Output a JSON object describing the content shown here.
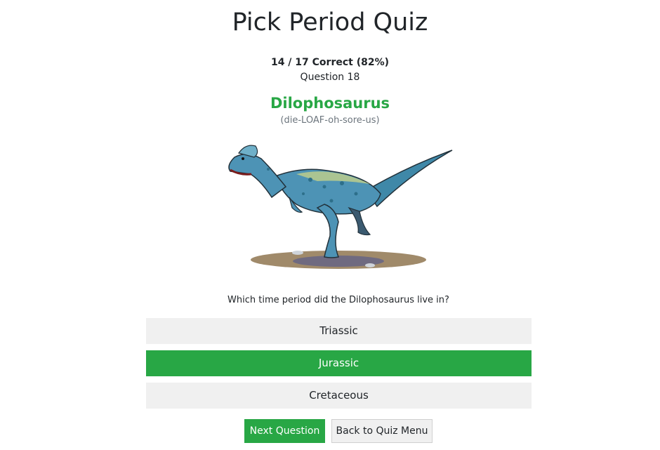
{
  "header": {
    "title": "Pick Period Quiz"
  },
  "progress": {
    "score_text": "14 / 17 Correct (82%)",
    "question_text": "Question 18"
  },
  "dinosaur": {
    "name": "Dilophosaurus",
    "pronunciation": "(die-LOAF-oh-sore-us)"
  },
  "question": {
    "text": "Which time period did the Dilophosaurus live in?"
  },
  "options": [
    {
      "label": "Triassic",
      "state": "default"
    },
    {
      "label": "Jurassic",
      "state": "correct"
    },
    {
      "label": "Cretaceous",
      "state": "default"
    }
  ],
  "actions": {
    "next_label": "Next Question",
    "back_label": "Back to Quiz Menu"
  },
  "colors": {
    "accent": "#28a745",
    "option_bg": "#f0f0f0",
    "text": "#212529"
  }
}
